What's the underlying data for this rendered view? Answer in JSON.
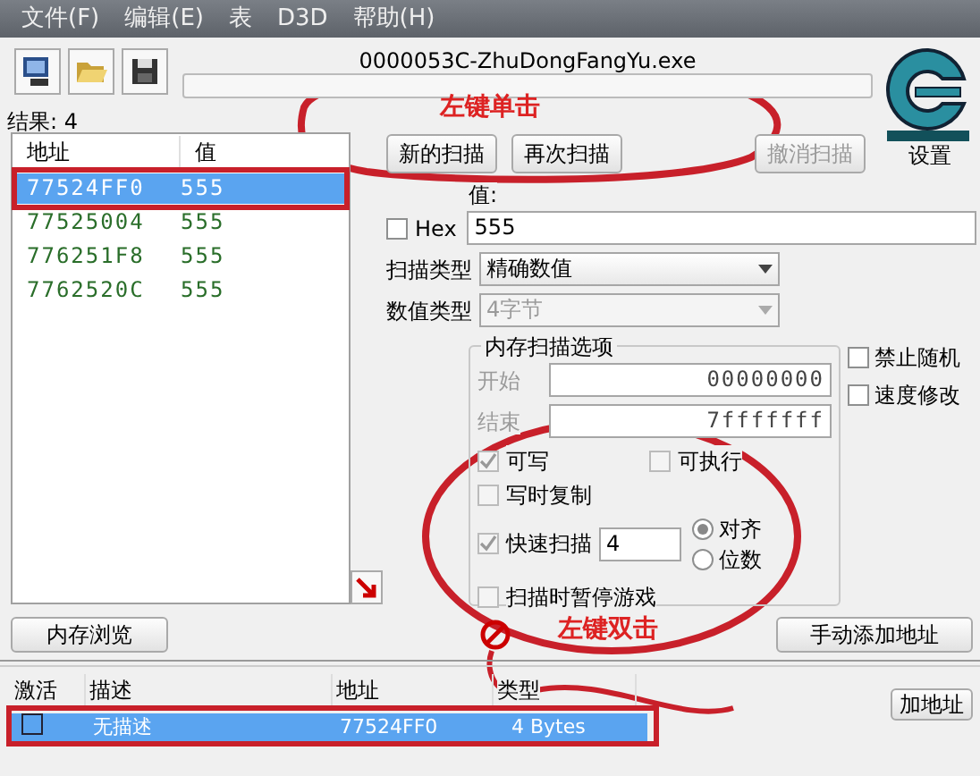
{
  "menu": [
    "文件(F)",
    "编辑(E)",
    "表",
    "D3D",
    "帮助(H)"
  ],
  "process_title": "0000053C-ZhuDongFangYu.exe",
  "scan_progress": {
    "level": 0
  },
  "results": "结果: 4",
  "found_list": {
    "columns": [
      "地址",
      "值"
    ],
    "rows": [
      {
        "address": "77524FF0",
        "value": "555",
        "selected": true
      },
      {
        "address": "77525004",
        "value": "555",
        "selected": false
      },
      {
        "address": "776251F8",
        "value": "555",
        "selected": false
      },
      {
        "address": "7762520C",
        "value": "555",
        "selected": false
      }
    ]
  },
  "scan_buttons": [
    {
      "label": "新的扫描",
      "disabled": false
    },
    {
      "label": "再次扫描",
      "disabled": false
    },
    {
      "label": "撤消扫描",
      "disabled": true
    }
  ],
  "logo_caption": "设置",
  "value": {
    "label": "值:",
    "hex": {
      "label": "Hex",
      "checked": false
    },
    "text": "555"
  },
  "scan_type": {
    "label": "扫描类型",
    "value": "精确数值",
    "disabled": false
  },
  "value_type": {
    "label": "数值类型",
    "value": "4字节",
    "disabled": true
  },
  "memory_options": {
    "title": "内存扫描选项",
    "disabled": true,
    "start": {
      "label": "开始",
      "value": "00000000"
    },
    "end": {
      "label": "结束",
      "value": "7fffffff"
    },
    "writable": {
      "label": "可写",
      "checked": true
    },
    "executable": {
      "label": "可执行",
      "checked": false
    },
    "copy_on_write": {
      "label": "写时复制",
      "checked": false
    },
    "fast_scan": {
      "label": "快速扫描",
      "checked": true,
      "value": "4"
    },
    "alignment": [
      {
        "label": "对齐",
        "selected": true
      },
      {
        "label": "位数",
        "selected": false
      }
    ],
    "pause": {
      "label": "扫描时暂停游戏",
      "checked": false
    }
  },
  "side_options": [
    {
      "label": "禁止随机",
      "checked": false
    },
    {
      "label": "速度修改",
      "checked": false
    }
  ],
  "memory_view_button": "内存浏览",
  "add_address_button": "手动添加地址",
  "address_table": {
    "columns": [
      "激活",
      "描述",
      "地址",
      "类型"
    ],
    "rows": [
      {
        "active": false,
        "description": "无描述",
        "address": "77524FF0",
        "type": "4 Bytes",
        "selected": true
      }
    ]
  },
  "extra_button": "加地址",
  "annotations": [
    {
      "text": "左键单击"
    },
    {
      "text": "左键双击"
    }
  ]
}
